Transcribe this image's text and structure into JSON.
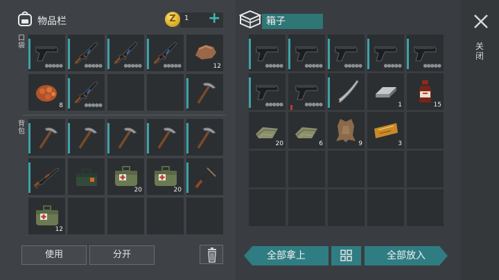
{
  "inventory": {
    "title": "物品栏",
    "pocket_label": "口袋",
    "backpack_label": "背包",
    "coins": "1"
  },
  "container": {
    "name": "箱子"
  },
  "close": {
    "label": "关闭"
  },
  "buttons": {
    "use": "使用",
    "split": "分开",
    "take_all": "全部拿上",
    "put_all": "全部放入"
  },
  "left_slots": [
    {
      "item": "pistol-icon",
      "cyan": true,
      "dots": true,
      "qty": ""
    },
    {
      "item": "rifle-icon",
      "cyan": true,
      "dots": true,
      "qty": ""
    },
    {
      "item": "rifle-icon",
      "cyan": true,
      "dots": true,
      "qty": ""
    },
    {
      "item": "rifle-icon",
      "cyan": true,
      "dots": true,
      "qty": ""
    },
    {
      "item": "stone-icon",
      "cyan": false,
      "dots": false,
      "qty": "12"
    },
    {
      "item": "ore-icon",
      "cyan": false,
      "dots": false,
      "qty": "8"
    },
    {
      "item": "rifle-icon",
      "cyan": true,
      "dots": true,
      "qty": ""
    },
    {
      "item": "empty",
      "cyan": false,
      "dots": false,
      "qty": ""
    },
    {
      "item": "empty",
      "cyan": false,
      "dots": false,
      "qty": ""
    },
    {
      "item": "pickaxe-icon",
      "cyan": true,
      "dots": false,
      "qty": ""
    },
    {
      "item": "pickaxe-icon",
      "cyan": true,
      "dots": false,
      "qty": ""
    },
    {
      "item": "pickaxe-icon",
      "cyan": true,
      "dots": false,
      "qty": ""
    },
    {
      "item": "pickaxe-icon",
      "cyan": true,
      "dots": false,
      "qty": ""
    },
    {
      "item": "pickaxe-icon",
      "cyan": true,
      "dots": false,
      "qty": ""
    },
    {
      "item": "pickaxe-icon",
      "cyan": true,
      "dots": false,
      "qty": ""
    },
    {
      "item": "shotgun-icon",
      "cyan": true,
      "dots": false,
      "qty": ""
    },
    {
      "item": "toolbox-icon",
      "cyan": false,
      "dots": false,
      "qty": ""
    },
    {
      "item": "medkit-icon",
      "cyan": false,
      "dots": false,
      "qty": "20"
    },
    {
      "item": "medkit-icon",
      "cyan": false,
      "dots": false,
      "qty": "20"
    },
    {
      "item": "crossbow-icon",
      "cyan": true,
      "dots": false,
      "qty": ""
    },
    {
      "item": "medkit-icon",
      "cyan": false,
      "dots": false,
      "qty": "12"
    },
    {
      "item": "empty",
      "cyan": false,
      "dots": false,
      "qty": ""
    },
    {
      "item": "empty",
      "cyan": false,
      "dots": false,
      "qty": ""
    },
    {
      "item": "empty",
      "cyan": false,
      "dots": false,
      "qty": ""
    },
    {
      "item": "empty",
      "cyan": false,
      "dots": false,
      "qty": ""
    }
  ],
  "right_slots": [
    {
      "item": "pistol-icon",
      "cyan": true,
      "red": false,
      "dots": true,
      "qty": ""
    },
    {
      "item": "pistol-icon",
      "cyan": true,
      "red": false,
      "dots": true,
      "qty": ""
    },
    {
      "item": "pistol-icon",
      "cyan": true,
      "red": false,
      "dots": true,
      "qty": ""
    },
    {
      "item": "pistol-icon",
      "cyan": true,
      "red": false,
      "dots": true,
      "qty": ""
    },
    {
      "item": "pistol-icon",
      "cyan": true,
      "red": false,
      "dots": true,
      "qty": ""
    },
    {
      "item": "pistol-icon",
      "cyan": true,
      "red": false,
      "dots": true,
      "qty": ""
    },
    {
      "item": "pistol-icon",
      "cyan": false,
      "red": true,
      "dots": true,
      "qty": ""
    },
    {
      "item": "machete-icon",
      "cyan": true,
      "red": false,
      "dots": false,
      "qty": ""
    },
    {
      "item": "metal-bar-icon",
      "cyan": false,
      "red": false,
      "dots": false,
      "qty": "1"
    },
    {
      "item": "bottle-icon",
      "cyan": false,
      "red": false,
      "dots": false,
      "qty": "15"
    },
    {
      "item": "cloth-icon",
      "cyan": false,
      "red": false,
      "dots": false,
      "qty": "20"
    },
    {
      "item": "cloth-icon",
      "cyan": false,
      "red": false,
      "dots": false,
      "qty": "6"
    },
    {
      "item": "leather-icon",
      "cyan": false,
      "red": false,
      "dots": false,
      "qty": "9"
    },
    {
      "item": "coupon-icon",
      "cyan": false,
      "red": false,
      "dots": false,
      "qty": "3"
    },
    {
      "item": "empty",
      "cyan": false,
      "red": false,
      "dots": false,
      "qty": ""
    }
  ],
  "colors": {
    "accent": "#2f7d82",
    "slot_bg": "#2b2f32",
    "cyan_marker": "#3ea3a8",
    "red_marker": "#c0392b"
  }
}
